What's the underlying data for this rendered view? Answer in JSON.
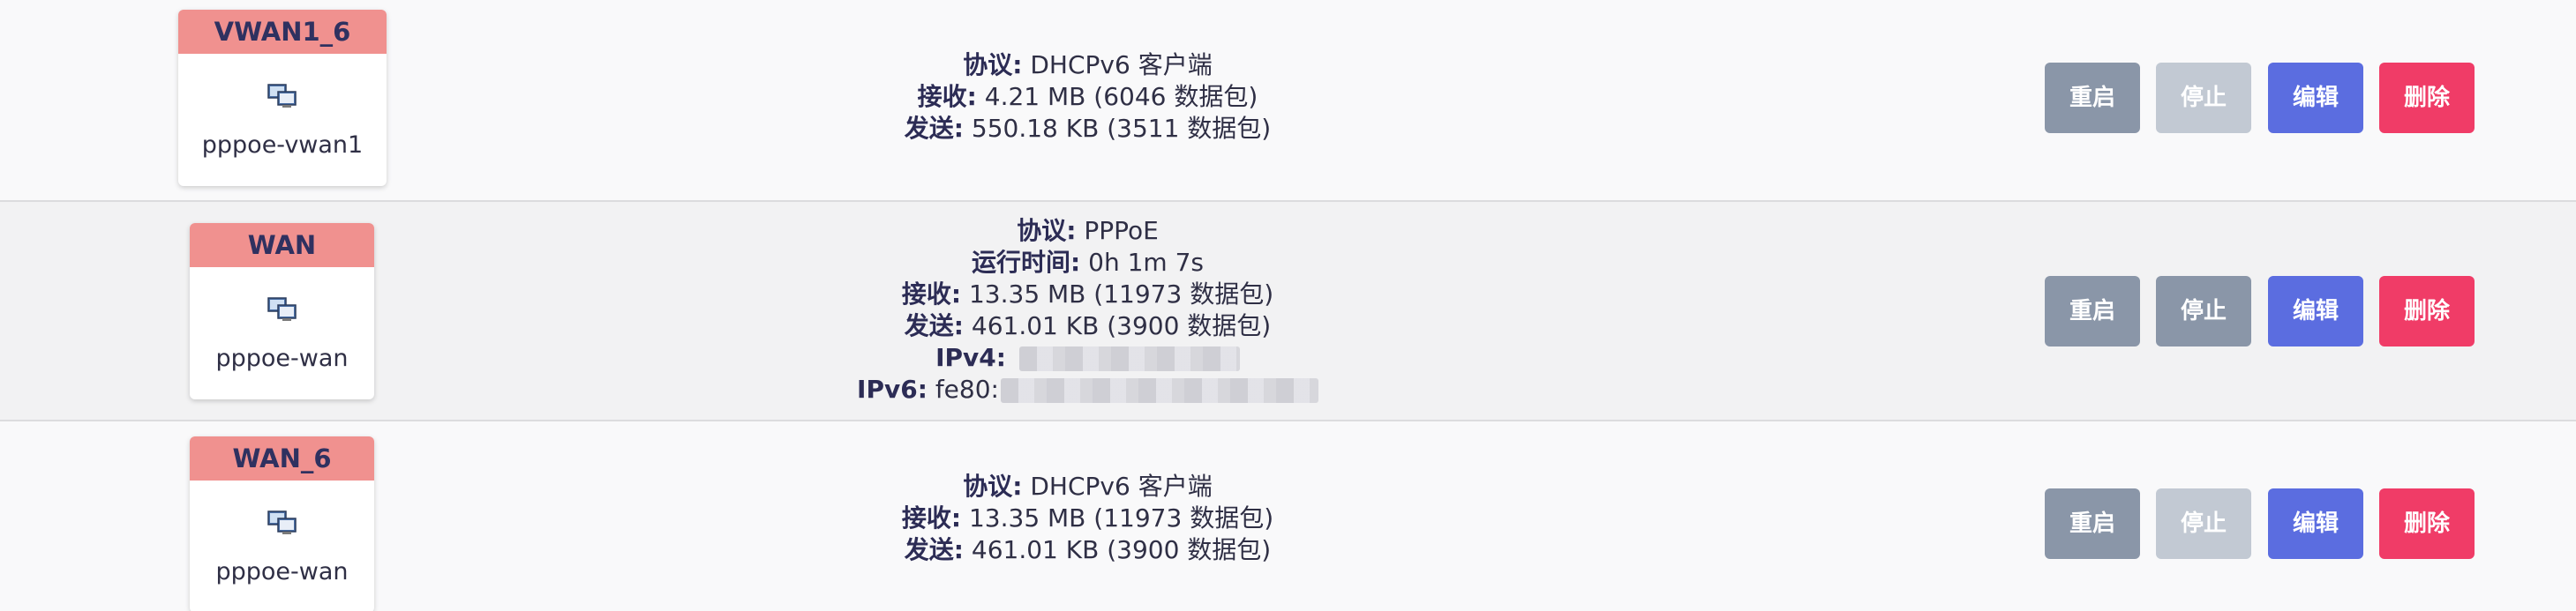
{
  "interfaces": [
    {
      "name": "VWAN1_6",
      "device": "pppoe-vwan1",
      "icon": "network-interface-icon",
      "info": [
        {
          "label": "协议:",
          "value": "DHCPv6 客户端"
        },
        {
          "label": "接收:",
          "value": "4.21 MB (6046 数据包)"
        },
        {
          "label": "发送:",
          "value": "550.18 KB (3511 数据包)"
        }
      ],
      "stop_disabled": true
    },
    {
      "name": "WAN",
      "device": "pppoe-wan",
      "icon": "network-interface-icon",
      "info": [
        {
          "label": "协议:",
          "value": "PPPoE"
        },
        {
          "label": "运行时间:",
          "value": "0h 1m 7s"
        },
        {
          "label": "接收:",
          "value": "13.35 MB (11973 数据包)"
        },
        {
          "label": "发送:",
          "value": "461.01 KB (3900 数据包)"
        },
        {
          "label": "IPv4:",
          "value": ""
        },
        {
          "label": "IPv6:",
          "value": "fe80:"
        }
      ],
      "stop_disabled": false
    },
    {
      "name": "WAN_6",
      "device": "pppoe-wan",
      "icon": "network-interface-icon",
      "info": [
        {
          "label": "协议:",
          "value": "DHCPv6 客户端"
        },
        {
          "label": "接收:",
          "value": "13.35 MB (11973 数据包)"
        },
        {
          "label": "发送:",
          "value": "461.01 KB (3900 数据包)"
        }
      ],
      "stop_disabled": true
    }
  ],
  "buttons": {
    "restart": "重启",
    "stop": "停止",
    "edit": "编辑",
    "delete": "删除"
  },
  "colors": {
    "badge_header": "#f0918f",
    "restart": "#8a96a8",
    "stop_disabled": "#c2c9d3",
    "edit": "#5b6de0",
    "delete": "#f03c67"
  }
}
